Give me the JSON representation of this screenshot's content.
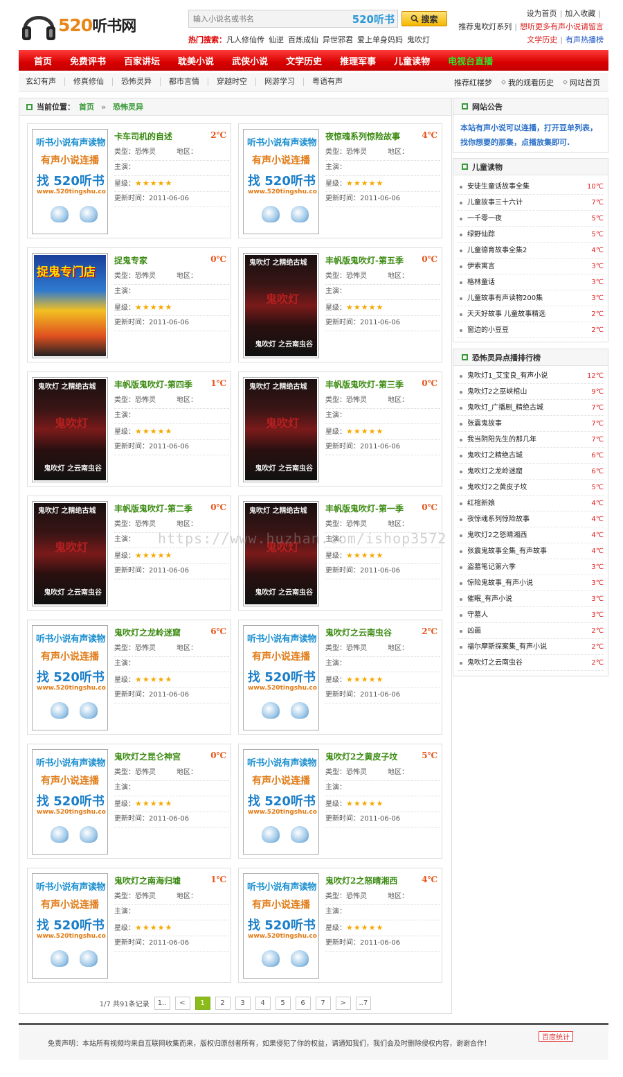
{
  "logo": {
    "brand_num": "520",
    "brand_text": "听书网"
  },
  "search": {
    "placeholder": "输入小说名或书名",
    "tag": "520听书",
    "button": "搜索"
  },
  "hot": {
    "label": "热门搜索：",
    "keywords": [
      "凡人修仙传",
      "仙逆",
      "百炼成仙",
      "异世邪君",
      "爱上单身妈妈",
      "鬼吹灯"
    ]
  },
  "toplinks": {
    "set_home": "设为首页",
    "favorite": "加入收藏",
    "recommend": "推荐鬼吹灯系列",
    "request": "想听更多有声小说请留言",
    "history": "文学历史",
    "hot_drama": "有声热播榜"
  },
  "nav": [
    "首页",
    "免费评书",
    "百家讲坛",
    "耽美小说",
    "武侠小说",
    "文学历史",
    "推理军事",
    "儿童读物",
    "电视台直播"
  ],
  "subnav": [
    "玄幻有声",
    "修真修仙",
    "恐怖灵异",
    "都市言情",
    "穿越时空",
    "网游学习",
    "粤语有声"
  ],
  "subright": [
    "推荐红楼梦",
    "我的观看历史",
    "网站首页"
  ],
  "breadcrumb": {
    "label": "当前位置：",
    "home": "首页",
    "sep": "»",
    "current": "恐怖灵异"
  },
  "field_labels": {
    "type": "类型：",
    "area": "地区：",
    "actor": "主演：",
    "rating": "星级：",
    "updated": "更新时间："
  },
  "items": [
    {
      "title": "卡车司机的自述",
      "temp": "2℃",
      "type": "恐怖灵",
      "updated": "2011-06-06",
      "stars": "★★★★★",
      "cover": "t1"
    },
    {
      "title": "夜惊魂系列惊险故事",
      "temp": "4℃",
      "type": "恐怖灵",
      "updated": "2011-06-06",
      "stars": "★★★★★",
      "cover": "t1"
    },
    {
      "title": "捉鬼专家",
      "temp": "0℃",
      "type": "恐怖灵",
      "updated": "2011-06-06",
      "stars": "★★★★★",
      "cover": "t2"
    },
    {
      "title": "丰帆版鬼吹灯-第五季",
      "temp": "0℃",
      "type": "恐怖灵",
      "updated": "2011-06-06",
      "stars": "★★★★★",
      "cover": "t3"
    },
    {
      "title": "丰帆版鬼吹灯-第四季",
      "temp": "1℃",
      "type": "恐怖灵",
      "updated": "2011-06-06",
      "stars": "★★★★★",
      "cover": "t3"
    },
    {
      "title": "丰帆版鬼吹灯-第三季",
      "temp": "0℃",
      "type": "恐怖灵",
      "updated": "2011-06-06",
      "stars": "★★★★★",
      "cover": "t3"
    },
    {
      "title": "丰帆版鬼吹灯-第二季",
      "temp": "0℃",
      "type": "恐怖灵",
      "updated": "2011-06-06",
      "stars": "★★★★★",
      "cover": "t3"
    },
    {
      "title": "丰帆版鬼吹灯-第一季",
      "temp": "0℃",
      "type": "恐怖灵",
      "updated": "2011-06-06",
      "stars": "★★★★★",
      "cover": "t3"
    },
    {
      "title": "鬼吹灯之龙岭迷窟",
      "temp": "6℃",
      "type": "恐怖灵",
      "updated": "2011-06-06",
      "stars": "★★★★★",
      "cover": "t1"
    },
    {
      "title": "鬼吹灯之云南虫谷",
      "temp": "2℃",
      "type": "恐怖灵",
      "updated": "2011-06-06",
      "stars": "★★★★★",
      "cover": "t1"
    },
    {
      "title": "鬼吹灯之昆仑神宫",
      "temp": "0℃",
      "type": "恐怖灵",
      "updated": "2011-06-06",
      "stars": "★★★★★",
      "cover": "t1"
    },
    {
      "title": "鬼吹灯2之黄皮子坟",
      "temp": "5℃",
      "type": "恐怖灵",
      "updated": "2011-06-06",
      "stars": "★★★★★",
      "cover": "t1"
    },
    {
      "title": "鬼吹灯之南海归墟",
      "temp": "1℃",
      "type": "恐怖灵",
      "updated": "2011-06-06",
      "stars": "★★★★★",
      "cover": "t1"
    },
    {
      "title": "鬼吹灯2之怒晴湘西",
      "temp": "4℃",
      "type": "恐怖灵",
      "updated": "2011-06-06",
      "stars": "★★★★★",
      "cover": "t1"
    }
  ],
  "cover_text": {
    "t1": [
      "听书小说有声读物",
      "有声小说连播",
      "找 520听书",
      "www.520tingshu.com"
    ],
    "t2": [
      "捉鬼专门店"
    ],
    "t3": [
      "鬼吹灯 之精绝古城",
      "鬼吹灯",
      "鬼吹灯 之云南虫谷"
    ]
  },
  "pager": {
    "summary": "1/7 共91条记录",
    "first": "1..",
    "prev": "<",
    "pages": [
      "1",
      "2",
      "3",
      "4",
      "5",
      "6",
      "7"
    ],
    "next": ">",
    "last": "..7",
    "current": "1"
  },
  "notice": {
    "title": "网站公告",
    "body": "本站有声小说可以连播，打开豆单列表，找你想要的那集，点播放集即可."
  },
  "kids": {
    "title": "儿童读物",
    "items": [
      {
        "name": "安徒生童话故事全集",
        "temp": "10℃"
      },
      {
        "name": "儿童故事三十六计",
        "temp": "7℃"
      },
      {
        "name": "一千零一夜",
        "temp": "5℃"
      },
      {
        "name": "绿野仙踪",
        "temp": "5℃"
      },
      {
        "name": "儿童德育故事全集2",
        "temp": "4℃"
      },
      {
        "name": "伊索寓言",
        "temp": "3℃"
      },
      {
        "name": "格林童话",
        "temp": "3℃"
      },
      {
        "name": "儿童故事有声读物200集",
        "temp": "3℃"
      },
      {
        "name": "天天好故事 儿童故事精选",
        "temp": "2℃"
      },
      {
        "name": "窗边的小豆豆",
        "temp": "2℃"
      }
    ]
  },
  "rank": {
    "title": "恐怖灵异点播排行榜",
    "items": [
      {
        "name": "鬼吹灯1_艾宝良_有声小说",
        "temp": "12℃"
      },
      {
        "name": "鬼吹灯2之巫峡棺山",
        "temp": "9℃"
      },
      {
        "name": "鬼吹灯_广播剧_精绝古城",
        "temp": "7℃"
      },
      {
        "name": "张震鬼故事",
        "temp": "7℃"
      },
      {
        "name": "我当阴阳先生的那几年",
        "temp": "7℃"
      },
      {
        "name": "鬼吹灯之精绝古城",
        "temp": "6℃"
      },
      {
        "name": "鬼吹灯之龙岭迷窟",
        "temp": "6℃"
      },
      {
        "name": "鬼吹灯2之黄皮子坟",
        "temp": "5℃"
      },
      {
        "name": "红棺新娘",
        "temp": "4℃"
      },
      {
        "name": "夜惊魂系列惊险故事",
        "temp": "4℃"
      },
      {
        "name": "鬼吹灯2之怒晴湘西",
        "temp": "4℃"
      },
      {
        "name": "张震鬼故事全集_有声故事",
        "temp": "4℃"
      },
      {
        "name": "盗墓笔记第六季",
        "temp": "3℃"
      },
      {
        "name": "惊险鬼故事_有声小说",
        "temp": "3℃"
      },
      {
        "name": "催眠_有声小说",
        "temp": "3℃"
      },
      {
        "name": "守墓人",
        "temp": "3℃"
      },
      {
        "name": "凶画",
        "temp": "2℃"
      },
      {
        "name": "福尔摩斯探案集_有声小说",
        "temp": "2℃"
      },
      {
        "name": "鬼吹灯之云南虫谷",
        "temp": "2℃"
      }
    ]
  },
  "footer": {
    "disclaimer": "免责声明：本站所有视频均来自互联网收集而来，版权归原创者所有，如果侵犯了你的权益，请通知我们，我们会及时删除侵权内容，谢谢合作！",
    "stat": "百度统计"
  },
  "watermark": "https://www.huzhan.com/ishop3572"
}
